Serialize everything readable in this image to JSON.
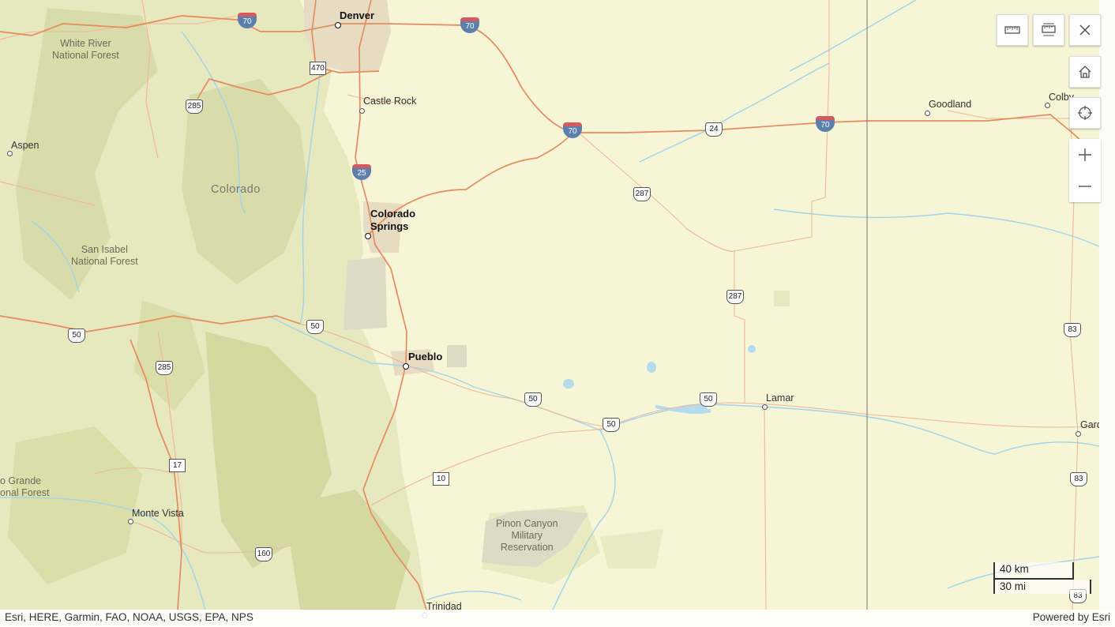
{
  "map": {
    "places": {
      "denver": "Denver",
      "castle_rock": "Castle Rock",
      "colorado_springs": "Colorado\nSprings",
      "pueblo": "Pueblo",
      "aspen": "Aspen",
      "goodland": "Goodland",
      "colby": "Colby",
      "lamar": "Lamar",
      "garden_city": "Gard",
      "monte_vista": "Monte Vista",
      "trinidad": "Trinidad"
    },
    "regions": {
      "colorado": "Colorado"
    },
    "parks": {
      "white_river": "White River\nNational Forest",
      "san_isabel": "San Isabel\nNational Forest",
      "rio_grande": "o Grande\nonal Forest",
      "pinon_canyon": "Pinon Canyon\nMilitary\nReservation"
    },
    "shields": {
      "i70_a": "70",
      "i70_b": "70",
      "i70_c": "70",
      "i70_d": "70",
      "i25": "25",
      "us285_a": "285",
      "us285_b": "285",
      "us24": "24",
      "us287_a": "287",
      "us287_b": "287",
      "us50_a": "50",
      "us50_b": "50",
      "us50_c": "50",
      "us50_d": "50",
      "us50_e": "50",
      "us160": "160",
      "us83_a": "83",
      "us83_b": "83",
      "us83_c": "83",
      "sr470": "470",
      "sr17": "17",
      "sr10": "10"
    },
    "colors": {
      "land": "#f6f5d6",
      "forest": "#dfe2b5",
      "forest_dark": "#cfd4a2",
      "highway": "#e8885a",
      "road": "#efb18a",
      "water": "#9fd3ea",
      "urban": "#e5dcc7",
      "military": "#dbd6c3"
    }
  },
  "controls": {
    "measure_line_icon": "ruler-icon",
    "measure_area_icon": "area-measure-icon",
    "close_icon": "close-icon",
    "home_icon": "home-icon",
    "locate_icon": "locate-icon",
    "zoom_in_icon": "plus-icon",
    "zoom_out_icon": "minus-icon"
  },
  "scale_bar": {
    "km_label": "40 km",
    "mi_label": "30 mi"
  },
  "attribution": {
    "sources": "Esri, HERE, Garmin, FAO, NOAA, USGS, EPA, NPS",
    "powered_by": "Powered by Esri"
  }
}
